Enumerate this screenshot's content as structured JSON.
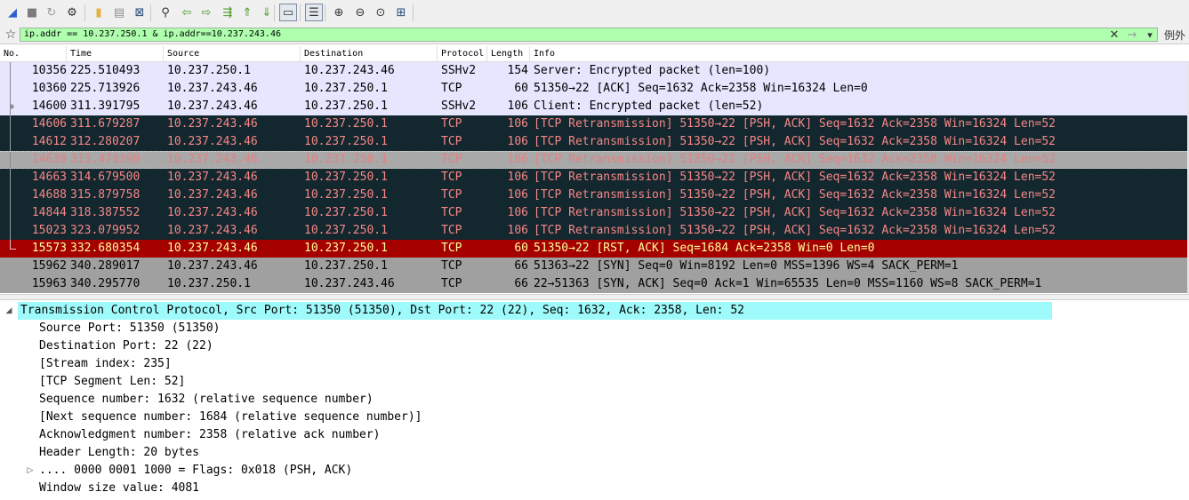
{
  "colors": {
    "filter_valid": "#afffaf",
    "row_default_bg": "#e7e6ff",
    "row_bad_tcp_bg": "#12272e",
    "row_bad_tcp_fg": "#f78787",
    "row_rst_bg": "#a40000",
    "row_rst_fg": "#fffc9c",
    "row_gray_bg": "#a0a0a0",
    "row_dim_bg": "#a9a9a9",
    "row_dim_fg": "#e38080",
    "detail_selected_bg": "#9ffbfb"
  },
  "toolbar": {
    "buttons": [
      {
        "name": "start-capture-icon",
        "glyph": "◢",
        "color": "#2f5fcf"
      },
      {
        "name": "stop-capture-icon",
        "glyph": "■",
        "color": "#7c7c7c"
      },
      {
        "name": "restart-capture-icon",
        "glyph": "↻",
        "color": "#9a9a9a"
      },
      {
        "name": "capture-options-icon",
        "glyph": "⚙",
        "color": "#333333"
      },
      {
        "name": "open-file-icon",
        "glyph": "▮",
        "color": "#e2b23a"
      },
      {
        "name": "save-file-icon",
        "glyph": "▤",
        "color": "#8f8f8f"
      },
      {
        "name": "close-file-icon",
        "glyph": "⊠",
        "color": "#27497a"
      },
      {
        "name": "find-packet-icon",
        "glyph": "⚲",
        "color": "#333333"
      },
      {
        "name": "go-back-icon",
        "glyph": "⇦",
        "color": "#4c9a2a"
      },
      {
        "name": "go-forward-icon",
        "glyph": "⇨",
        "color": "#4c9a2a"
      },
      {
        "name": "go-to-packet-icon",
        "glyph": "⇶",
        "color": "#4c9a2a"
      },
      {
        "name": "go-first-icon",
        "glyph": "⇑",
        "color": "#4c9a2a"
      },
      {
        "name": "go-last-icon",
        "glyph": "⇓",
        "color": "#4c9a2a"
      },
      {
        "name": "autoscroll-icon",
        "glyph": "▭",
        "color": "#333333"
      },
      {
        "name": "colorize-icon",
        "glyph": "☰",
        "color": "#333333"
      },
      {
        "name": "zoom-in-icon",
        "glyph": "⊕",
        "color": "#333333"
      },
      {
        "name": "zoom-out-icon",
        "glyph": "⊖",
        "color": "#333333"
      },
      {
        "name": "zoom-normal-icon",
        "glyph": "⊙",
        "color": "#333333"
      },
      {
        "name": "resize-columns-icon",
        "glyph": "⊞",
        "color": "#27497a"
      }
    ]
  },
  "filter": {
    "bookmark_icon": "☆",
    "value": "ip.addr == 10.237.250.1 & ip.addr==10.237.243.46",
    "clear_icon": "✕",
    "apply_icon": "→",
    "dropdown_icon": "▾",
    "expression_label": "例外"
  },
  "columns": [
    "No.",
    "Time",
    "Source",
    "Destination",
    "Protocol",
    "Length",
    "Info"
  ],
  "packets": [
    {
      "no": "10356",
      "time": "225.510493",
      "src": "10.237.250.1",
      "dst": "10.237.243.46",
      "proto": "SSHv2",
      "len": "154",
      "info": "Server: Encrypted packet (len=100)",
      "style": "default",
      "mark": "line"
    },
    {
      "no": "10360",
      "time": "225.713926",
      "src": "10.237.243.46",
      "dst": "10.237.250.1",
      "proto": "TCP",
      "len": "60",
      "info": "51350→22 [ACK] Seq=1632 Ack=2358 Win=16324 Len=0",
      "style": "default",
      "mark": "line"
    },
    {
      "no": "14600",
      "time": "311.391795",
      "src": "10.237.243.46",
      "dst": "10.237.250.1",
      "proto": "SSHv2",
      "len": "106",
      "info": "Client: Encrypted packet (len=52)",
      "style": "default",
      "mark": "dot"
    },
    {
      "no": "14606",
      "time": "311.679287",
      "src": "10.237.243.46",
      "dst": "10.237.250.1",
      "proto": "TCP",
      "len": "106",
      "info": "[TCP Retransmission] 51350→22 [PSH, ACK] Seq=1632 Ack=2358 Win=16324 Len=52",
      "style": "bad",
      "mark": "line"
    },
    {
      "no": "14612",
      "time": "312.280207",
      "src": "10.237.243.46",
      "dst": "10.237.250.1",
      "proto": "TCP",
      "len": "106",
      "info": "[TCP Retransmission] 51350→22 [PSH, ACK] Seq=1632 Ack=2358 Win=16324 Len=52",
      "style": "bad",
      "mark": "line"
    },
    {
      "no": "14639",
      "time": "313.479390",
      "src": "10.237.243.46",
      "dst": "10.237.250.1",
      "proto": "TCP",
      "len": "106",
      "info": "[TCP Retransmission] 51350→22 [PSH, ACK] Seq=1632 Ack=2358 Win=16324 Len=52",
      "style": "selected",
      "mark": "line"
    },
    {
      "no": "14663",
      "time": "314.679500",
      "src": "10.237.243.46",
      "dst": "10.237.250.1",
      "proto": "TCP",
      "len": "106",
      "info": "[TCP Retransmission] 51350→22 [PSH, ACK] Seq=1632 Ack=2358 Win=16324 Len=52",
      "style": "bad",
      "mark": "line"
    },
    {
      "no": "14688",
      "time": "315.879758",
      "src": "10.237.243.46",
      "dst": "10.237.250.1",
      "proto": "TCP",
      "len": "106",
      "info": "[TCP Retransmission] 51350→22 [PSH, ACK] Seq=1632 Ack=2358 Win=16324 Len=52",
      "style": "bad",
      "mark": "line"
    },
    {
      "no": "14844",
      "time": "318.387552",
      "src": "10.237.243.46",
      "dst": "10.237.250.1",
      "proto": "TCP",
      "len": "106",
      "info": "[TCP Retransmission] 51350→22 [PSH, ACK] Seq=1632 Ack=2358 Win=16324 Len=52",
      "style": "bad",
      "mark": "line"
    },
    {
      "no": "15023",
      "time": "323.079952",
      "src": "10.237.243.46",
      "dst": "10.237.250.1",
      "proto": "TCP",
      "len": "106",
      "info": "[TCP Retransmission] 51350→22 [PSH, ACK] Seq=1632 Ack=2358 Win=16324 Len=52",
      "style": "bad",
      "mark": "line"
    },
    {
      "no": "15573",
      "time": "332.680354",
      "src": "10.237.243.46",
      "dst": "10.237.250.1",
      "proto": "TCP",
      "len": "60",
      "info": "51350→22 [RST, ACK] Seq=1684 Ack=2358 Win=0 Len=0",
      "style": "rst",
      "mark": "end"
    },
    {
      "no": "15962",
      "time": "340.289017",
      "src": "10.237.243.46",
      "dst": "10.237.250.1",
      "proto": "TCP",
      "len": "66",
      "info": "51363→22 [SYN] Seq=0 Win=8192 Len=0 MSS=1396 WS=4 SACK_PERM=1",
      "style": "gray",
      "mark": "none"
    },
    {
      "no": "15963",
      "time": "340.295770",
      "src": "10.237.250.1",
      "dst": "10.237.243.46",
      "proto": "TCP",
      "len": "66",
      "info": "22→51363 [SYN, ACK] Seq=0 Ack=1 Win=65535 Len=0 MSS=1160 WS=8 SACK_PERM=1",
      "style": "gray",
      "mark": "none"
    }
  ],
  "details": [
    {
      "text": "Transmission Control Protocol, Src Port: 51350 (51350), Dst Port: 22 (22), Seq: 1632, Ack: 2358, Len: 52",
      "level": 0,
      "toggle": "expanded",
      "selected": true
    },
    {
      "text": "Source Port: 51350 (51350)",
      "level": 1,
      "toggle": "none",
      "selected": false
    },
    {
      "text": "Destination Port: 22 (22)",
      "level": 1,
      "toggle": "none",
      "selected": false
    },
    {
      "text": "[Stream index: 235]",
      "level": 1,
      "toggle": "none",
      "selected": false
    },
    {
      "text": "[TCP Segment Len: 52]",
      "level": 1,
      "toggle": "none",
      "selected": false
    },
    {
      "text": "Sequence number: 1632    (relative sequence number)",
      "level": 1,
      "toggle": "none",
      "selected": false
    },
    {
      "text": "[Next sequence number: 1684    (relative sequence number)]",
      "level": 1,
      "toggle": "none",
      "selected": false
    },
    {
      "text": "Acknowledgment number: 2358    (relative ack number)",
      "level": 1,
      "toggle": "none",
      "selected": false
    },
    {
      "text": "Header Length: 20 bytes",
      "level": 1,
      "toggle": "none",
      "selected": false
    },
    {
      "text": ".... 0000 0001 1000 = Flags: 0x018 (PSH, ACK)",
      "level": 1,
      "toggle": "collapsed",
      "selected": false
    },
    {
      "text": "Window size value: 4081",
      "level": 1,
      "toggle": "none",
      "selected": false
    }
  ]
}
